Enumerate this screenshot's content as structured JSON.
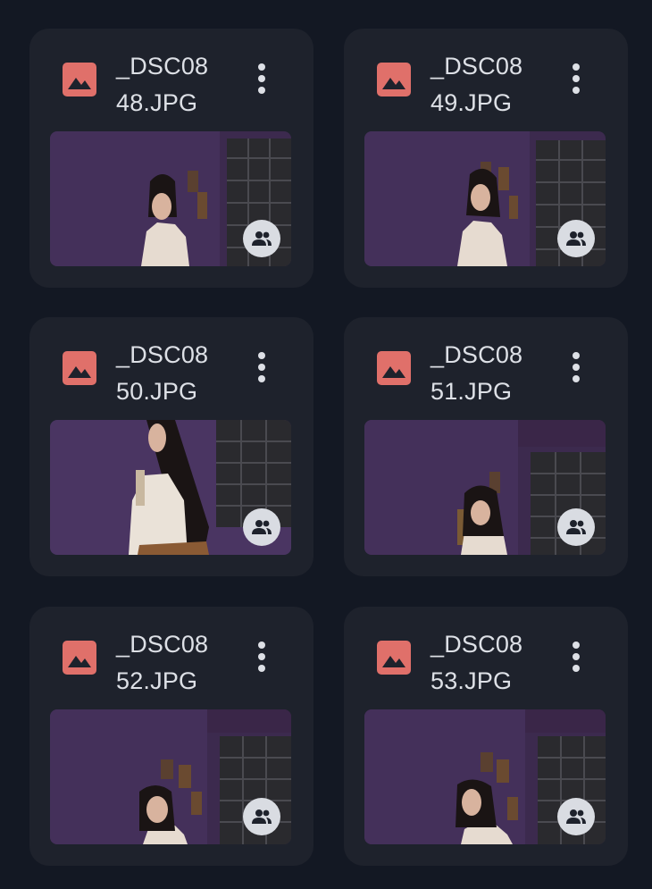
{
  "colors": {
    "background": "#131823",
    "card": "#1e222c",
    "text": "#dde0e6",
    "image_icon": "#e0706a",
    "shared_badge": "#d9dce2"
  },
  "files": [
    {
      "name_line1": "_DSC08",
      "name_line2": "48.JPG",
      "icon": "image-file-icon",
      "badge": "shared-people-icon"
    },
    {
      "name_line1": "_DSC08",
      "name_line2": "49.JPG",
      "icon": "image-file-icon",
      "badge": "shared-people-icon"
    },
    {
      "name_line1": "_DSC08",
      "name_line2": "50.JPG",
      "icon": "image-file-icon",
      "badge": "shared-people-icon"
    },
    {
      "name_line1": "_DSC08",
      "name_line2": "51.JPG",
      "icon": "image-file-icon",
      "badge": "shared-people-icon"
    },
    {
      "name_line1": "_DSC08",
      "name_line2": "52.JPG",
      "icon": "image-file-icon",
      "badge": "shared-people-icon"
    },
    {
      "name_line1": "_DSC08",
      "name_line2": "53.JPG",
      "icon": "image-file-icon",
      "badge": "shared-people-icon"
    }
  ]
}
